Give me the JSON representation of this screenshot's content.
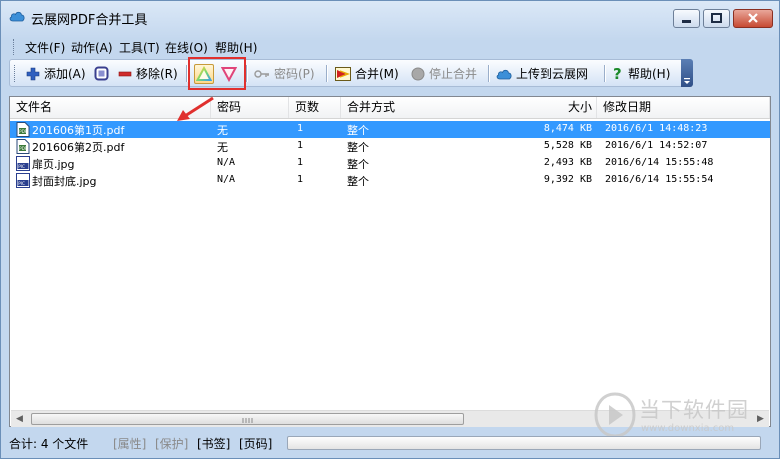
{
  "window": {
    "title": "云展网PDF合并工具",
    "accent": "#3399ff"
  },
  "menu": [
    {
      "label": "文件(F)"
    },
    {
      "label": "动作(A)"
    },
    {
      "label": "工具(T)"
    },
    {
      "label": "在线(O)"
    },
    {
      "label": "帮助(H)"
    }
  ],
  "toolbar": {
    "add": "添加(A)",
    "remove": "移除(R)",
    "password": "密码(P)",
    "merge": "合并(M)",
    "stop_merge": "停止合并",
    "upload": "上传到云展网",
    "help": "帮助(H)"
  },
  "table": {
    "columns": [
      "文件名",
      "密码",
      "页数",
      "合并方式",
      "大小",
      "修改日期"
    ],
    "rows": [
      {
        "name": "201606第1页.pdf",
        "password": "无",
        "pages": "1",
        "mode": "整个",
        "size": "8,474 KB",
        "modified": "2016/6/1 14:48:23",
        "type": "pdf",
        "selected": true
      },
      {
        "name": "201606第2页.pdf",
        "password": "无",
        "pages": "1",
        "mode": "整个",
        "size": "5,528 KB",
        "modified": "2016/6/1 14:52:07",
        "type": "pdf",
        "selected": false
      },
      {
        "name": "扉页.jpg",
        "password": "N/A",
        "pages": "1",
        "mode": "整个",
        "size": "2,493 KB",
        "modified": "2016/6/14 15:55:48",
        "type": "jpg",
        "selected": false
      },
      {
        "name": "封面封底.jpg",
        "password": "N/A",
        "pages": "1",
        "mode": "整个",
        "size": "9,392 KB",
        "modified": "2016/6/14 15:55:54",
        "type": "jpg",
        "selected": false
      }
    ]
  },
  "status": {
    "total": "合计: 4 个文件",
    "attrs": "[属性]",
    "protect": "[保护]",
    "bookmark": "[书签]",
    "pageno": "[页码]"
  },
  "watermark": {
    "text": "当下软件园",
    "url": "www.downxia.com"
  }
}
